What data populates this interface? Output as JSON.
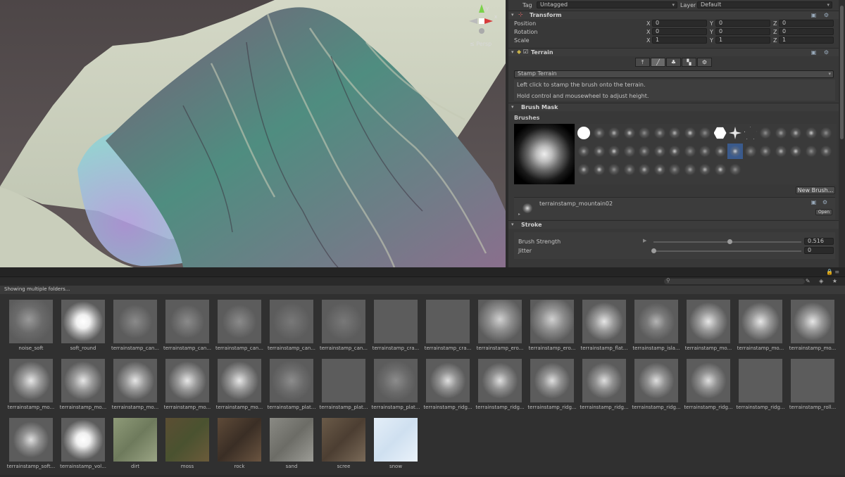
{
  "scene": {
    "persp_label": "≤ Persp",
    "gizmo_axes": {
      "y": "y",
      "x": "x"
    }
  },
  "inspector": {
    "tag_label": "Tag",
    "tag_value": "Untagged",
    "layer_label": "Layer",
    "layer_value": "Default",
    "transform": {
      "title": "Transform",
      "rows": [
        {
          "label": "Position",
          "x": "0",
          "y": "0",
          "z": "0"
        },
        {
          "label": "Rotation",
          "x": "0",
          "y": "0",
          "z": "0"
        },
        {
          "label": "Scale",
          "x": "1",
          "y": "1",
          "z": "1"
        }
      ],
      "axis_x": "X",
      "axis_y": "Y",
      "axis_z": "Z"
    },
    "terrain": {
      "title": "Terrain",
      "tool_dropdown": "Stamp Terrain",
      "help_line_1": "Left click to stamp the brush onto the terrain.",
      "help_line_2": "Hold control and mousewheel to adjust height."
    },
    "brush_mask": {
      "title": "Brush Mask",
      "brushes_label": "Brushes",
      "new_brush_button": "New Brush...",
      "selected_brush_name": "terrainstamp_mountain02",
      "open_button": "Open"
    },
    "stroke": {
      "title": "Stroke",
      "brush_strength_label": "Brush Strength",
      "brush_strength_value": "0.516",
      "brush_strength_level": 0.516,
      "jitter_label": "Jitter",
      "jitter_value": "0",
      "jitter_level": 0
    }
  },
  "project": {
    "showing_label": "Showing multiple folders...",
    "assets": [
      {
        "name": "noise_soft",
        "kind": "noise"
      },
      {
        "name": "soft_round",
        "kind": "round"
      },
      {
        "name": "terrainstamp_can...",
        "kind": "canyon"
      },
      {
        "name": "terrainstamp_can...",
        "kind": "canyon"
      },
      {
        "name": "terrainstamp_can...",
        "kind": "canyon"
      },
      {
        "name": "terrainstamp_can...",
        "kind": "canyon-faint"
      },
      {
        "name": "terrainstamp_can...",
        "kind": "canyon-faint"
      },
      {
        "name": "terrainstamp_cra...",
        "kind": "flat"
      },
      {
        "name": "terrainstamp_cra...",
        "kind": "flat"
      },
      {
        "name": "terrainstamp_ero...",
        "kind": "erosion"
      },
      {
        "name": "terrainstamp_ero...",
        "kind": "erosion"
      },
      {
        "name": "terrainstamp_flat...",
        "kind": "mountain"
      },
      {
        "name": "terrainstamp_isla...",
        "kind": "island"
      },
      {
        "name": "terrainstamp_mo...",
        "kind": "mountain"
      },
      {
        "name": "terrainstamp_mo...",
        "kind": "mountain"
      },
      {
        "name": "terrainstamp_mo...",
        "kind": "mountain"
      },
      {
        "name": "terrainstamp_mo...",
        "kind": "mountain"
      },
      {
        "name": "terrainstamp_mo...",
        "kind": "mountain"
      },
      {
        "name": "terrainstamp_mo...",
        "kind": "mountain"
      },
      {
        "name": "terrainstamp_mo...",
        "kind": "mountain"
      },
      {
        "name": "terrainstamp_mo...",
        "kind": "mountain"
      },
      {
        "name": "terrainstamp_plat...",
        "kind": "plateau"
      },
      {
        "name": "terrainstamp_plat...",
        "kind": "flat"
      },
      {
        "name": "terrainstamp_plat...",
        "kind": "plateau"
      },
      {
        "name": "terrainstamp_ridg...",
        "kind": "ridge"
      },
      {
        "name": "terrainstamp_ridg...",
        "kind": "ridge"
      },
      {
        "name": "terrainstamp_ridg...",
        "kind": "ridge"
      },
      {
        "name": "terrainstamp_ridg...",
        "kind": "ridge"
      },
      {
        "name": "terrainstamp_ridg...",
        "kind": "ridge"
      },
      {
        "name": "terrainstamp_ridg...",
        "kind": "ridge"
      },
      {
        "name": "terrainstamp_ridg...",
        "kind": "flat"
      },
      {
        "name": "terrainstamp_roll...",
        "kind": "flat"
      },
      {
        "name": "terrainstamp_soft...",
        "kind": "ridge"
      },
      {
        "name": "terrainstamp_vol...",
        "kind": "round"
      },
      {
        "name": "dirt",
        "kind": "dirt"
      },
      {
        "name": "moss",
        "kind": "moss"
      },
      {
        "name": "rock",
        "kind": "rock"
      },
      {
        "name": "sand",
        "kind": "sand"
      },
      {
        "name": "scree",
        "kind": "scree"
      },
      {
        "name": "snow",
        "kind": "snow"
      }
    ]
  },
  "colors": {
    "panel": "#383838",
    "field": "#2a2a2a",
    "accent_selected": "#3a5a8c"
  }
}
